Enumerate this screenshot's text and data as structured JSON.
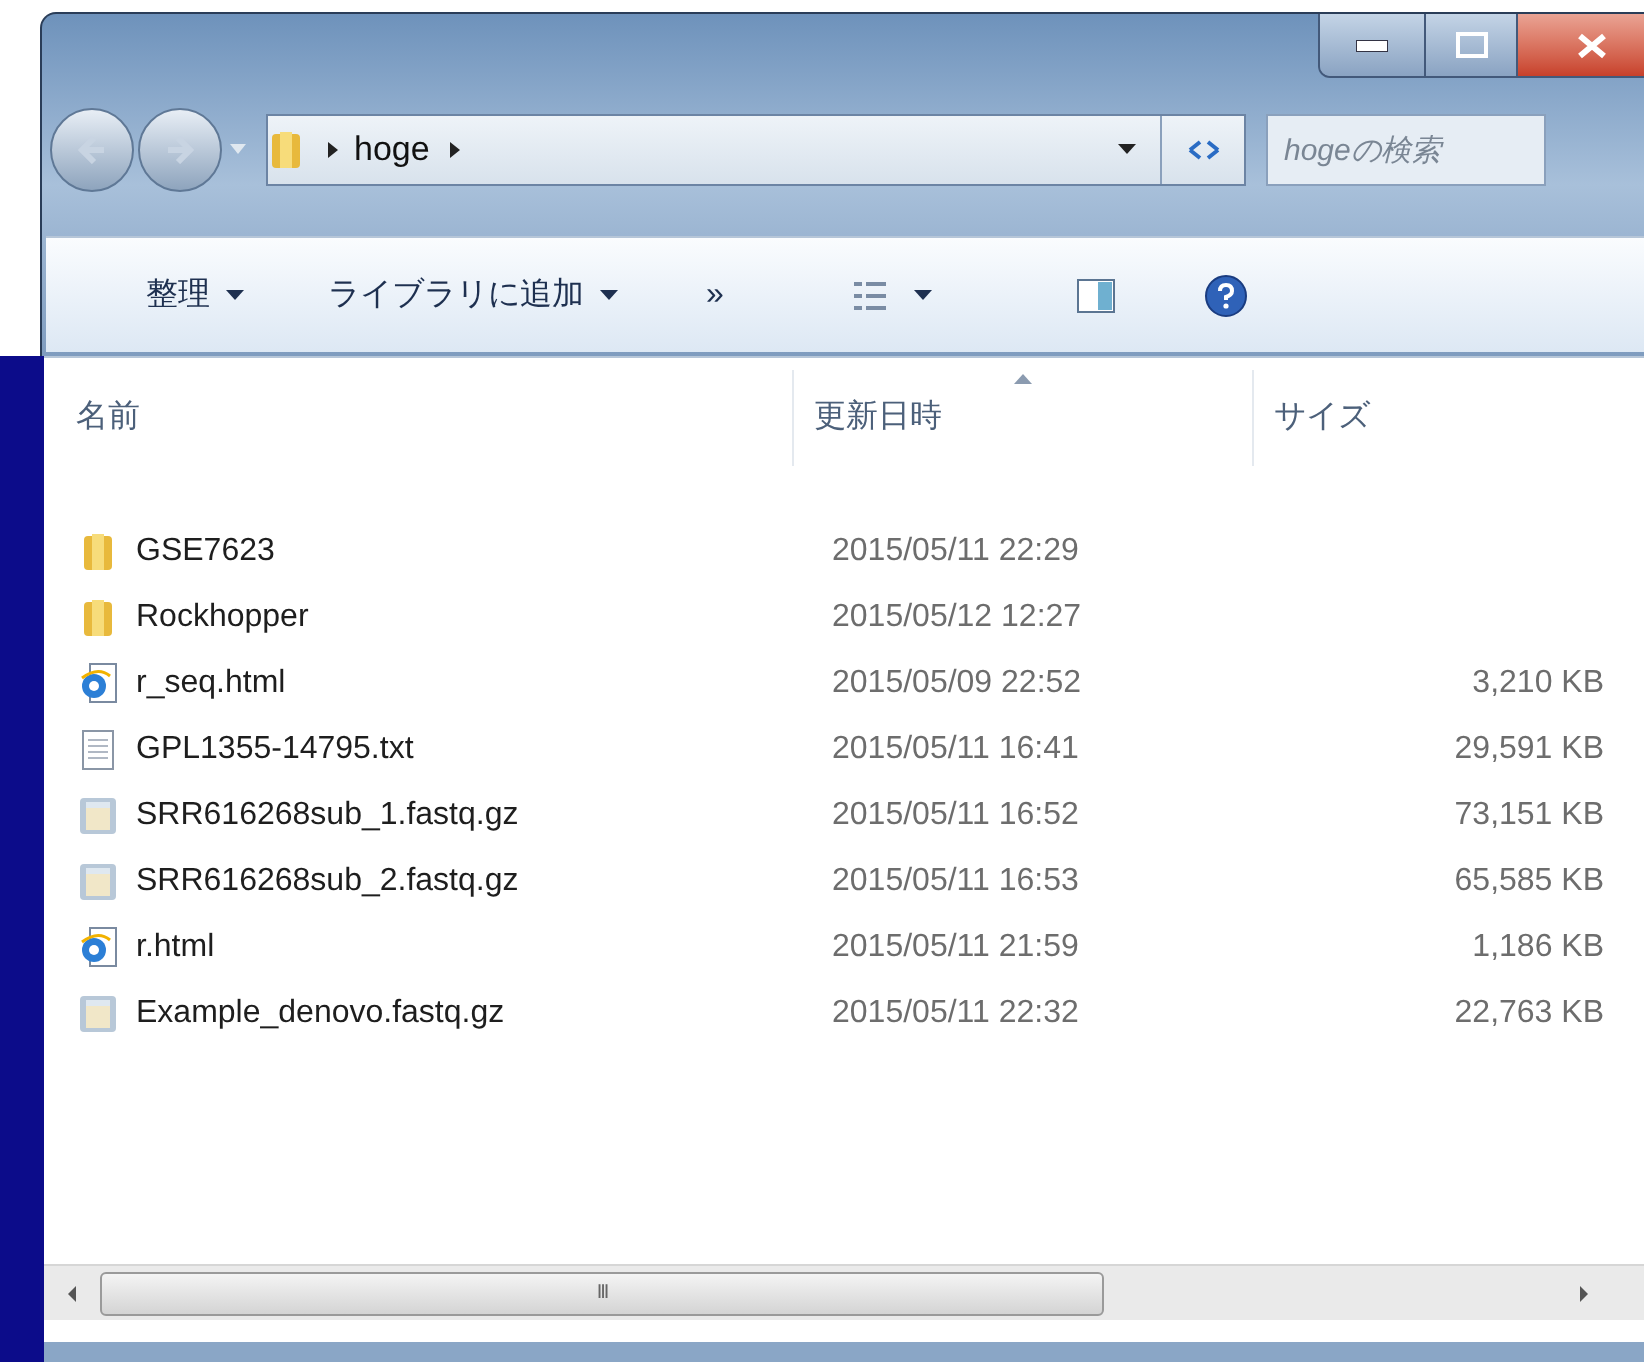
{
  "address_bar": {
    "path": "hoge"
  },
  "search": {
    "placeholder": "hogeの検索"
  },
  "toolbar": {
    "items": [
      {
        "kind": "menu",
        "label": "整理"
      },
      {
        "kind": "menu",
        "label": "ライブラリに追加"
      },
      {
        "kind": "more",
        "label": "»"
      }
    ]
  },
  "table": {
    "columns": [
      {
        "label": "名前",
        "sorted": false
      },
      {
        "label": "更新日時",
        "sorted": true
      },
      {
        "label": "サイズ",
        "sorted": false
      }
    ],
    "rows": [
      {
        "kind": "folder",
        "name": "GSE7623",
        "modified": "2015/05/11 22:29"
      },
      {
        "kind": "folder",
        "name": "Rockhopper",
        "modified": "2015/05/12 12:27"
      },
      {
        "kind": "html",
        "name": "r_seq.html",
        "modified": "2015/05/09 22:52",
        "size": "3,210 KB"
      },
      {
        "kind": "text",
        "name": "GPL1355-14795.txt",
        "modified": "2015/05/11 16:41",
        "size": "29,591 KB"
      },
      {
        "kind": "archive",
        "name": "SRR616268sub_1.fastq.gz",
        "modified": "2015/05/11 16:52",
        "size": "73,151 KB"
      },
      {
        "kind": "archive",
        "name": "SRR616268sub_2.fastq.gz",
        "modified": "2015/05/11 16:53",
        "size": "65,585 KB"
      },
      {
        "kind": "html",
        "name": "r.html",
        "modified": "2015/05/11 21:59",
        "size": "1,186 KB"
      },
      {
        "kind": "archive",
        "name": "Example_denovo.fastq.gz",
        "modified": "2015/05/11 22:32",
        "size": "22,763 KB"
      }
    ]
  },
  "scrollbar": {
    "grip": "III"
  }
}
